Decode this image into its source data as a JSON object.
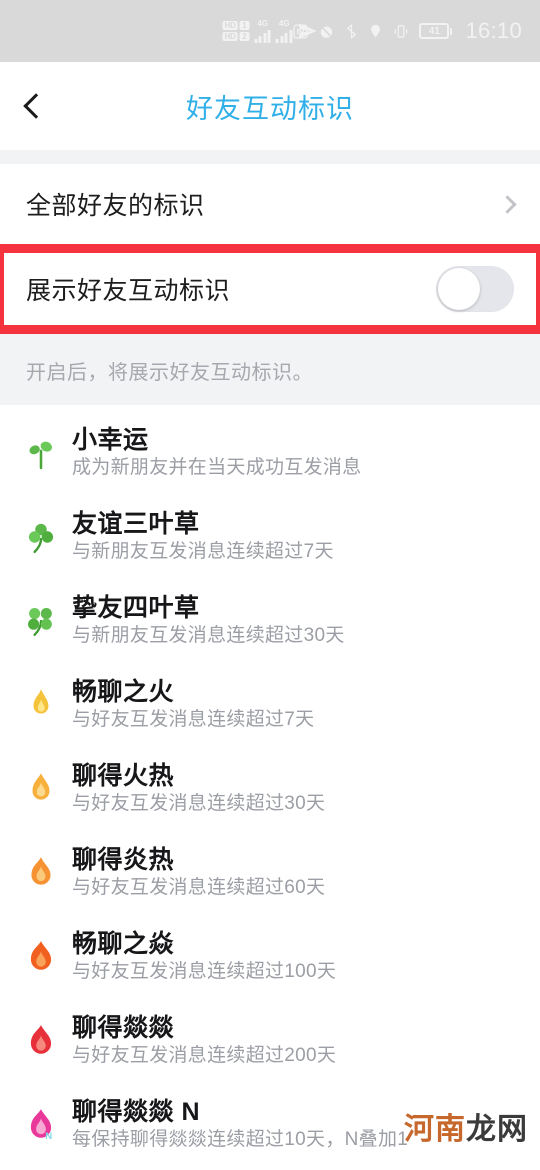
{
  "statusbar": {
    "sim1_hd": "HD",
    "sim1_num": "1",
    "sim2_hd": "HD",
    "sim2_num": "2",
    "net1": "4G",
    "net2": "4G",
    "icons": [
      "send-icon",
      "nfc-icon",
      "alarm-off-icon",
      "bluetooth-icon",
      "location-icon",
      "vibrate-icon"
    ],
    "battery_percent": "41",
    "time": "16:10"
  },
  "header": {
    "back_icon": "chevron-left-icon",
    "title": "好友互动标识",
    "title_color": "#31b0e8"
  },
  "rows": {
    "all_friends": {
      "label": "全部好友的标识",
      "chevron": "chevron-right-icon"
    },
    "show_badges": {
      "label": "展示好友互动标识",
      "toggle_state": "off",
      "highlight_color": "#f5333f"
    }
  },
  "hint": "开启后，将展示好友互动标识。",
  "badges": [
    {
      "icon": "sprout-icon",
      "glyph": "🌱",
      "title": "小幸运",
      "desc": "成为新朋友并在当天成功互发消息"
    },
    {
      "icon": "three-leaf-clover-icon",
      "glyph": "☘",
      "title": "友谊三叶草",
      "desc": "与新朋友互发消息连续超过7天"
    },
    {
      "icon": "four-leaf-clover-icon",
      "glyph": "🍀",
      "title": "挚友四叶草",
      "desc": "与新朋友互发消息连续超过30天"
    },
    {
      "icon": "flame-yellow-icon",
      "glyph": "🔥",
      "title": "畅聊之火",
      "desc": "与好友互发消息连续超过7天"
    },
    {
      "icon": "flame-light-orange-icon",
      "glyph": "🔥",
      "title": "聊得火热",
      "desc": "与好友互发消息连续超过30天"
    },
    {
      "icon": "flame-orange-icon",
      "glyph": "🔥",
      "title": "聊得炎热",
      "desc": "与好友互发消息连续超过60天"
    },
    {
      "icon": "flame-deep-orange-icon",
      "glyph": "🔥",
      "title": "畅聊之焱",
      "desc": "与好友互发消息连续超过100天"
    },
    {
      "icon": "flame-red-icon",
      "glyph": "🔥",
      "title": "聊得燚燚",
      "desc": "与好友互发消息连续超过200天"
    },
    {
      "icon": "flame-pink-n-icon",
      "glyph": "🔥",
      "title": "聊得燚燚 N",
      "desc": "每保持聊得燚燚连续超过10天，N叠加1"
    }
  ],
  "watermark": {
    "part1": "河南",
    "part2": "龙网"
  }
}
